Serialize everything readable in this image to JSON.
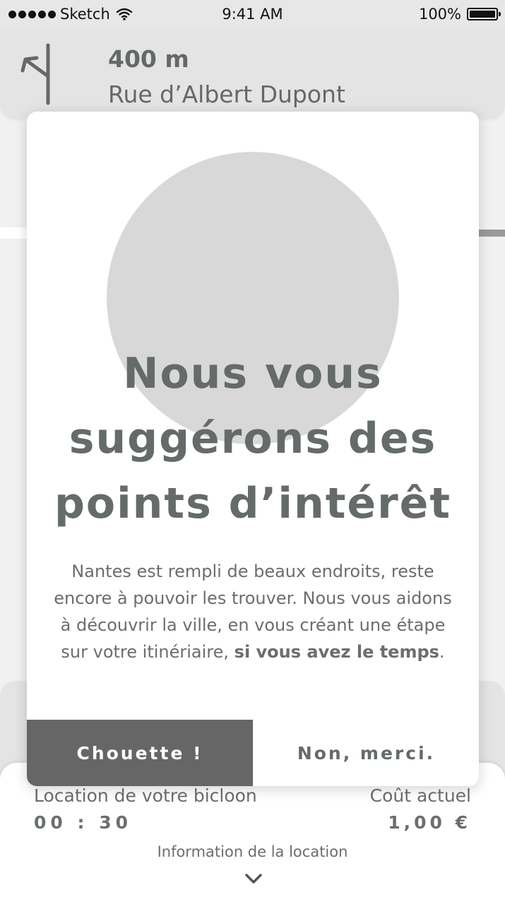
{
  "status_bar": {
    "carrier": "Sketch",
    "time": "9:41 AM",
    "battery": "100%"
  },
  "navigation": {
    "distance": "400 m",
    "street": "Rue d’Albert Dupont",
    "turn_icon": "turn-left-icon"
  },
  "modal": {
    "title": "Nous vous suggérons des points d’intérêt",
    "body_text": "Nantes est rempli de beaux endroits, reste encore à pouvoir les trouver. Nous vous aidons à découvrir la ville, en vous créant une étape sur votre itinériaire, ",
    "body_bold": "si vous avez le temps",
    "body_end": ".",
    "accept_label": "Chouette !",
    "decline_label": "Non, merci."
  },
  "rental": {
    "label": "Location de votre bicloon",
    "duration": "00 : 30",
    "cost_label": "Coût actuel",
    "cost_value": "1,00 €",
    "info_link": "Information de la location"
  },
  "colors": {
    "accent_button": "#666666",
    "text_gray": "#656a6a",
    "image_placeholder": "#d8d8d8"
  }
}
